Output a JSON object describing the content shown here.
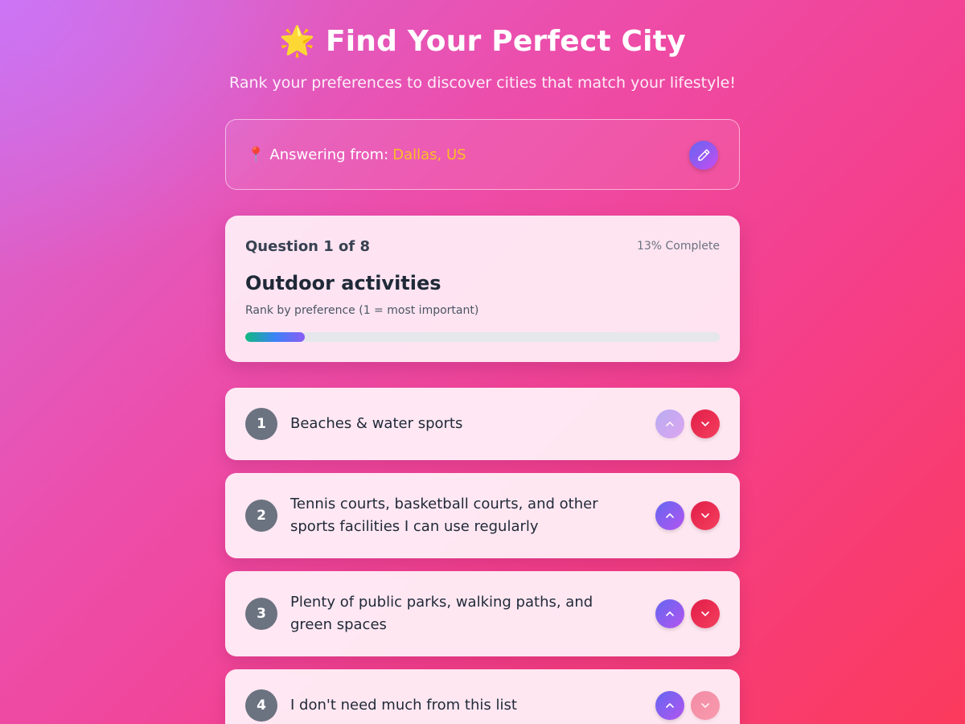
{
  "header": {
    "title": "🌟 Find Your Perfect City",
    "subtitle": "Rank your preferences to discover cities that match your lifestyle!"
  },
  "location": {
    "pin": "📍",
    "prefix": "Answering from:",
    "city": "Dallas, US"
  },
  "question": {
    "counter": "Question 1 of 8",
    "percent_label": "13% Complete",
    "progress": 0.125,
    "title": "Outdoor activities",
    "hint": "Rank by preference (1 = most important)"
  },
  "options": [
    {
      "rank": "1",
      "text": "Beaches & water sports"
    },
    {
      "rank": "2",
      "text": "Tennis courts, basketball courts, and other sports facilities I can use regularly"
    },
    {
      "rank": "3",
      "text": "Plenty of public parks, walking paths, and green spaces"
    },
    {
      "rank": "4",
      "text": "I don't need much from this list"
    }
  ],
  "colors": {
    "accent_city": "#fbbf24",
    "up_button": "#6366f1",
    "down_button": "#e11d48",
    "rank_badge": "#6b7280"
  }
}
